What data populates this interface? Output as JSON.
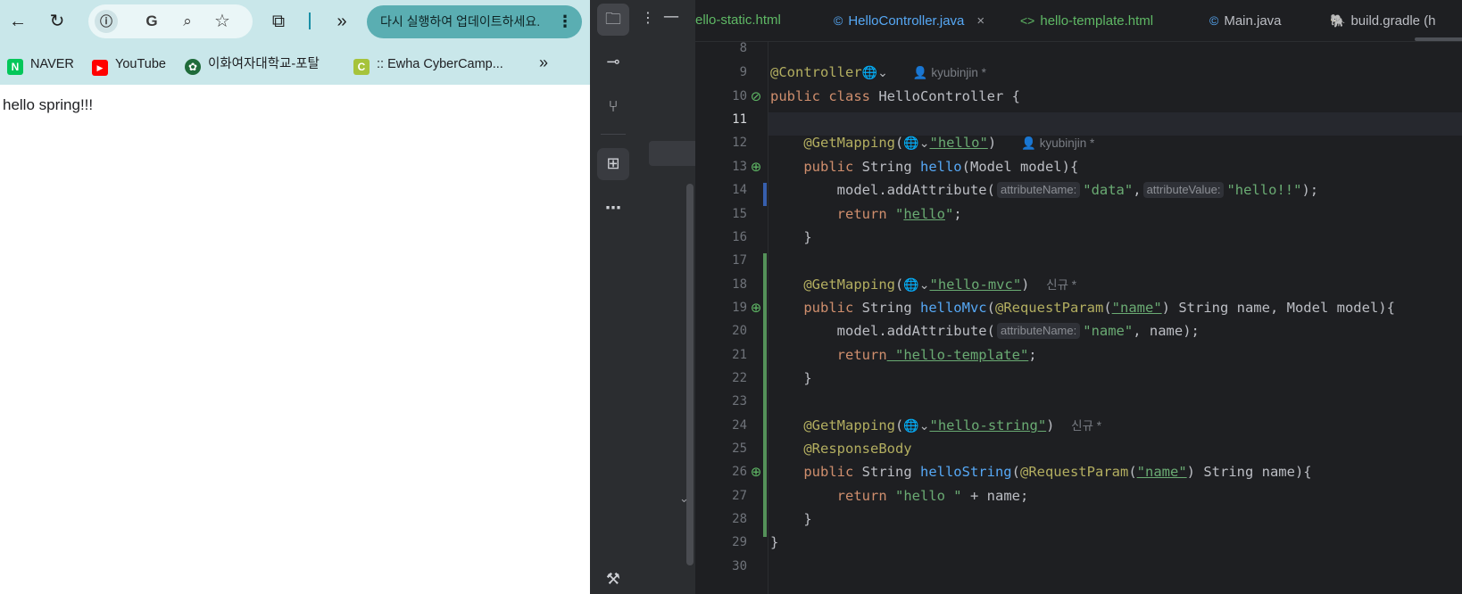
{
  "browser": {
    "toolbar": {
      "back_icon": "←",
      "reload_icon": "↻",
      "info_icon": "ⓘ",
      "translate_icon": "G",
      "zoom_icon": "⌕",
      "star_icon": "☆",
      "extensions_icon": "⧉",
      "more_icon": "»",
      "update_text": "다시 실행하여 업데이트하세요.",
      "update_menu": "⋮"
    },
    "bookmarks": [
      {
        "label": "NAVER",
        "icon_text": "N",
        "color": "#03c75a"
      },
      {
        "label": "YouTube",
        "icon_text": "▶",
        "color": "#ff0000"
      },
      {
        "label": "이화여자대학교-포탈",
        "icon_text": "✿",
        "color": "#1f6b3a"
      },
      {
        "label": ":: Ewha CyberCamp...",
        "icon_text": "C",
        "color": "#a6c33b"
      }
    ],
    "bookmarks_more": "»",
    "page_text": "hello spring!!!"
  },
  "ide": {
    "toolbar": {
      "project_icon": "🗀",
      "commit_icon": "⊸",
      "pull_requests_icon": "⑂",
      "structure_icon": "⊞",
      "more_icon": "⋯",
      "build_icon": "⚒",
      "project_menu_icon": "⋮",
      "minimize_icon": "—",
      "tree_chevron": "⌄"
    },
    "tabs": [
      {
        "label": "ello-static.html",
        "icon": "",
        "color": "#5fb865"
      },
      {
        "label": "HelloController.java",
        "icon": "©",
        "color": "#56a8f5",
        "close": "×"
      },
      {
        "label": "hello-template.html",
        "icon": "<>",
        "color": "#5fb865"
      },
      {
        "label": "Main.java",
        "icon": "©",
        "color": "#bcbec4"
      },
      {
        "label": "build.gradle (h",
        "icon": "🐘",
        "color": "#bcbec4"
      }
    ],
    "line_numbers": [
      "8",
      "9",
      "10",
      "11",
      "12",
      "13",
      "14",
      "15",
      "16",
      "17",
      "18",
      "19",
      "20",
      "21",
      "22",
      "23",
      "24",
      "25",
      "26",
      "27",
      "28",
      "29",
      "30"
    ],
    "code": {
      "l9_ann": "@Controller",
      "l9_globe": "🌐⌄",
      "l9_author": "👤 kyubinjin *",
      "l10_kw": "public class",
      "l10_rest": " HelloController {",
      "l12_ann": "@GetMapping",
      "l12_open": "(",
      "l12_str": "\"hello\"",
      "l12_close": ")",
      "l12_author": "👤 kyubinjin *",
      "l13_kw": "public",
      "l13_type": " String ",
      "l13_fn": "hello",
      "l13_rest": "(Model model){",
      "l14_a": "model.addAttribute(",
      "l14_hint1": "attributeName:",
      "l14_s1": "\"data\"",
      "l14_comma": ",",
      "l14_hint2": "attributeValue:",
      "l14_s2": "\"hello!!\"",
      "l14_end": ");",
      "l15_kw": "return",
      "l15_q1": " \"",
      "l15_s": "hello",
      "l15_q2": "\"",
      "l15_end": ";",
      "l16": "}",
      "l18_ann": "@GetMapping",
      "l18_open": "(",
      "l18_str": "\"hello-mvc\"",
      "l18_close": ")",
      "l18_new": "신규 *",
      "l19_kw": "public",
      "l19_type": " String ",
      "l19_fn": "helloMvc",
      "l19_p1": "(",
      "l19_ann": "@RequestParam",
      "l19_p2": "(",
      "l19_s": "\"name\"",
      "l19_rest": ") String name, Model model){",
      "l20_a": "model.addAttribute(",
      "l20_hint": "attributeName:",
      "l20_s": "\"name\"",
      "l20_end": ", name);",
      "l21_kw": "return",
      "l21_s": " \"hello-template\"",
      "l21_end": ";",
      "l22": "}",
      "l24_ann": "@GetMapping",
      "l24_open": "(",
      "l24_str": "\"hello-string\"",
      "l24_close": ")",
      "l24_new": "신규 *",
      "l25_ann": "@ResponseBody",
      "l26_kw": "public",
      "l26_type": " String ",
      "l26_fn": "helloString",
      "l26_p1": "(",
      "l26_ann": "@RequestParam",
      "l26_p2": "(",
      "l26_s": "\"name\"",
      "l26_rest": ") String name){",
      "l27_kw": "return",
      "l27_s": " \"hello \"",
      "l27_rest": " + name;",
      "l28": "}",
      "l29": "}"
    },
    "colors": {
      "keyword": "#cf8e6d",
      "annotation": "#b3ae60",
      "string": "#6aab73",
      "function": "#56a8f5",
      "text": "#bcbec4",
      "vcs_added": "#549159",
      "vcs_modified": "#375fad"
    }
  }
}
